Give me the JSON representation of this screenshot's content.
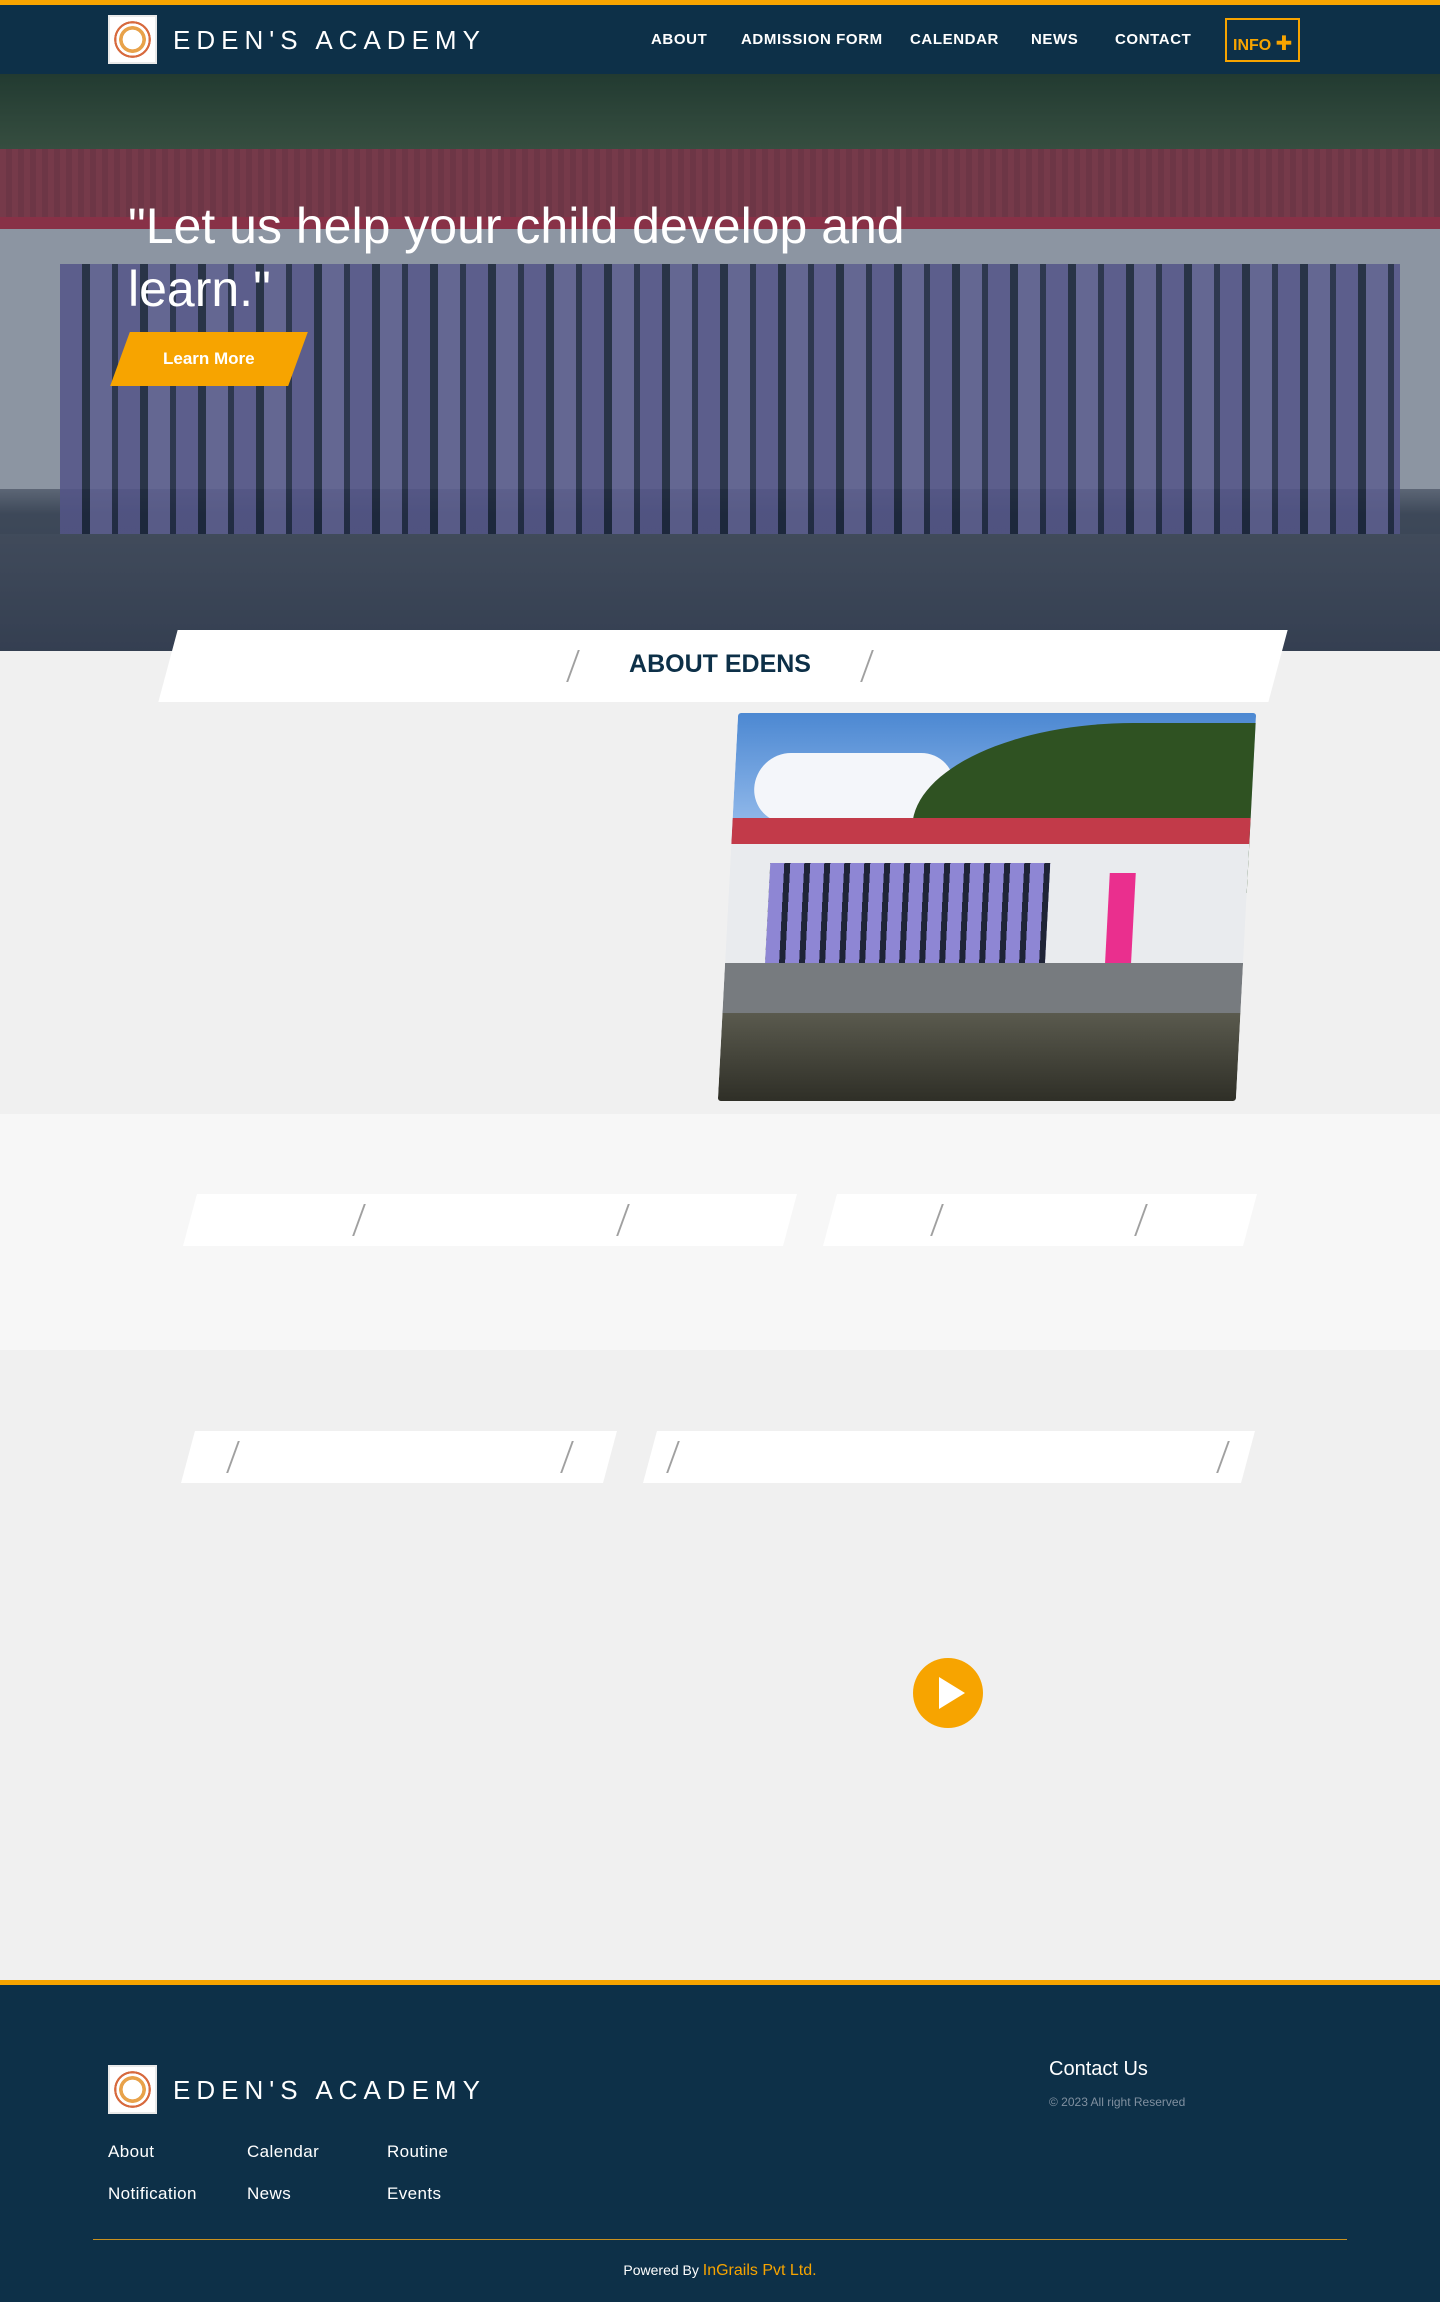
{
  "nav": {
    "brand": "EDEN'S ACADEMY",
    "items": [
      "ABOUT",
      "ADMISSION FORM",
      "CALENDAR",
      "NEWS",
      "CONTACT"
    ],
    "info_label": "INFO",
    "info_icon": "plus-icon"
  },
  "hero": {
    "quote": "\"Let us help your child develop and learn.\"",
    "button_label": "Learn More"
  },
  "about": {
    "title": "ABOUT EDENS"
  },
  "footer": {
    "brand": "EDEN'S ACADEMY",
    "links": [
      "About",
      "Calendar",
      "Routine",
      "Notification",
      "News",
      "Events"
    ],
    "contact_title": "Contact Us",
    "copyright": "© 2023 All right Reserved",
    "powered_prefix": "Powered By",
    "powered_link": "InGrails Pvt Ltd."
  },
  "colors": {
    "navy": "#0d3048",
    "accent": "#f7a400"
  }
}
